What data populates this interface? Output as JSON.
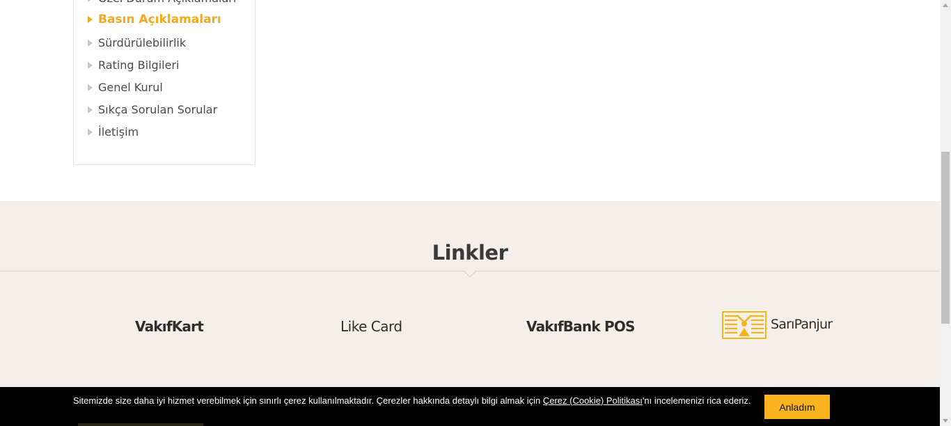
{
  "side_menu": {
    "items": [
      {
        "label": "Özel Durum Açıklamaları",
        "active": false
      },
      {
        "label": "Basın Açıklamaları",
        "active": true
      },
      {
        "label": "Sürdürülebilirlik",
        "active": false
      },
      {
        "label": "Rating Bilgileri",
        "active": false
      },
      {
        "label": "Genel Kurul",
        "active": false
      },
      {
        "label": "Sıkça Sorulan Sorular",
        "active": false
      },
      {
        "label": "İletişim",
        "active": false
      }
    ]
  },
  "links": {
    "title": "Linkler",
    "items": [
      {
        "label": "VakıfKart"
      },
      {
        "label": "Like Card"
      },
      {
        "label": "VakıfBank POS"
      },
      {
        "label": "SarıPanjur"
      }
    ]
  },
  "cookie": {
    "text_before": "Sitemizde size daha iyi hizmet verebilmek için sınırlı çerez kullanılmaktadır. Çerezler hakkında detaylı bilgi almak için ",
    "link_text": "Çerez (Cookie) Politikası",
    "text_after": "'nı incelemenizi rica ederiz.",
    "button_label": "Anladım"
  },
  "colors": {
    "accent": "#f4a91c",
    "links_bg": "#f5efea",
    "cookie_bg": "#000000",
    "cookie_button": "#fcb31e"
  }
}
